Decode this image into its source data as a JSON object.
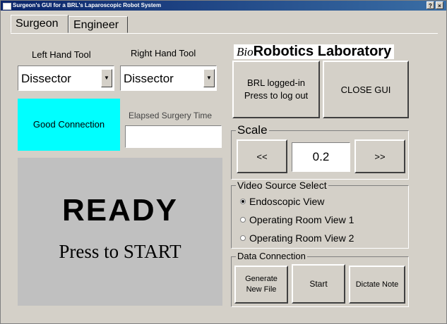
{
  "window": {
    "title": "Surgeon's GUI for a BRL's Laparoscopic Robot System",
    "help_label": "?",
    "close_label": "×"
  },
  "tabs": [
    {
      "label": "Surgeon",
      "active": true
    },
    {
      "label": "Engineer",
      "active": false
    }
  ],
  "tools": {
    "left_label": "Left Hand Tool",
    "right_label": "Right Hand Tool",
    "left_value": "Dissector",
    "right_value": "Dissector"
  },
  "connection": {
    "status": "Good Connection",
    "color": "#00ffff"
  },
  "elapsed": {
    "label": "Elapsed Surgery Time",
    "value": ""
  },
  "ready_panel": {
    "title": "READY",
    "subtitle": "Press to START"
  },
  "logo": {
    "bio": "Bio",
    "text": "Robotics Laboratory"
  },
  "buttons": {
    "login": "BRL logged-in Press to log out",
    "close_gui": "CLOSE GUI"
  },
  "scale": {
    "label": "Scale",
    "decrease": "<<",
    "value": "0.2",
    "increase": ">>"
  },
  "video": {
    "label": "Video Source Select",
    "options": [
      {
        "label": "Endoscopic View",
        "selected": true
      },
      {
        "label": "Operating Room View 1",
        "selected": false
      },
      {
        "label": "Operating Room View 2",
        "selected": false
      }
    ]
  },
  "data_connection": {
    "label": "Data Connection",
    "generate": "Generate New File",
    "start": "Start",
    "dictate": "Dictate Note"
  }
}
